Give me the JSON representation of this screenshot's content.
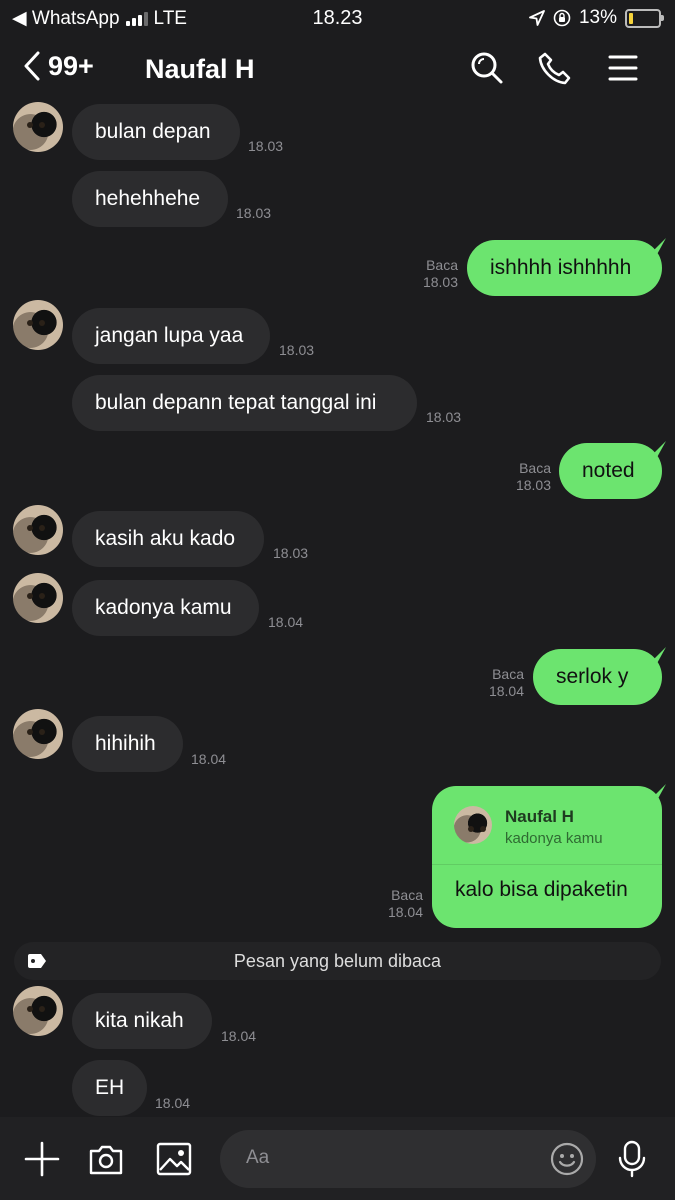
{
  "status_bar": {
    "back_app": "◀ WhatsApp",
    "network": "LTE",
    "time": "18.23",
    "battery_percent": "13%",
    "battery_level": 0.13
  },
  "header": {
    "unread_count": "99+",
    "contact_name": "Naufal H"
  },
  "messages": [
    {
      "side": "in",
      "text": "bulan depan",
      "time": "18.03"
    },
    {
      "side": "in",
      "text": "hehehhehe",
      "time": "18.03"
    },
    {
      "side": "out",
      "text": "ishhhh ishhhhh",
      "read": "Baca",
      "time": "18.03"
    },
    {
      "side": "in",
      "text": "jangan lupa yaa",
      "time": "18.03"
    },
    {
      "side": "in",
      "text": "bulan depann tepat tanggal ini",
      "time": "18.03"
    },
    {
      "side": "out",
      "text": "noted",
      "read": "Baca",
      "time": "18.03"
    },
    {
      "side": "in",
      "text": "kasih aku kado",
      "time": "18.03"
    },
    {
      "side": "in",
      "text": "kadonya kamu",
      "time": "18.04"
    },
    {
      "side": "out",
      "text": "serlok y",
      "read": "Baca",
      "time": "18.04"
    },
    {
      "side": "in",
      "text": "hihihih",
      "time": "18.04"
    },
    {
      "side": "in",
      "text": "kita nikah",
      "time": "18.04"
    },
    {
      "side": "in",
      "text": "EH",
      "time": "18.04"
    }
  ],
  "reply_message": {
    "quoted_name": "Naufal H",
    "quoted_text": "kadonya kamu",
    "text": "kalo bisa dipaketin",
    "read": "Baca",
    "time": "18.04"
  },
  "unread_divider": "Pesan yang belum dibaca",
  "composer": {
    "placeholder": "Aa"
  },
  "colors": {
    "background": "#1c1c1e",
    "incoming_bubble": "#2c2c2e",
    "outgoing_bubble": "#6ce46f",
    "meta_text": "#8e8e93"
  }
}
